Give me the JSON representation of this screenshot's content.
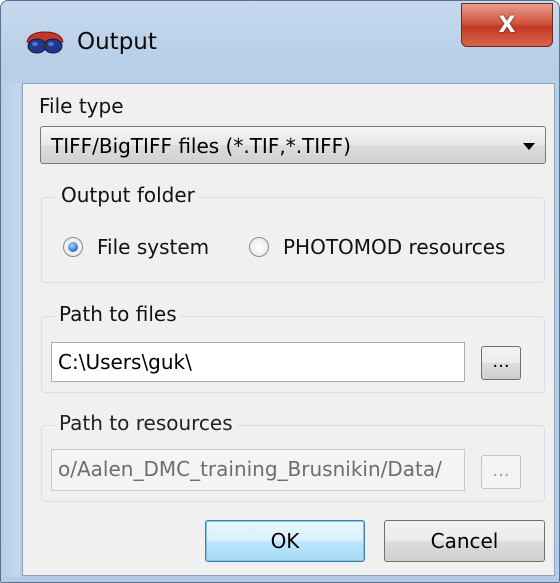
{
  "window": {
    "title": "Output",
    "close_label": "X"
  },
  "file_type": {
    "label": "File type",
    "selected": "TIFF/BigTIFF files (*.TIF,*.TIFF)"
  },
  "output_folder": {
    "title": "Output folder",
    "options": [
      {
        "label": "File system",
        "selected": true
      },
      {
        "label": "PHOTOMOD resources",
        "selected": false
      }
    ]
  },
  "path_to_files": {
    "title": "Path to files",
    "value": "C:\\Users\\guk\\",
    "browse_label": "..."
  },
  "path_to_resources": {
    "title": "Path to resources",
    "value": "o/Aalen_DMC_training_Brusnikin/Data/",
    "browse_label": "...",
    "enabled": false
  },
  "buttons": {
    "ok": "OK",
    "cancel": "Cancel"
  },
  "colors": {
    "accent": "#3c7fb1",
    "close_button": "#c23a23",
    "radio_selected": "#2c6fbf"
  },
  "icons": {
    "title": "red-blue-3d-glasses-icon"
  }
}
